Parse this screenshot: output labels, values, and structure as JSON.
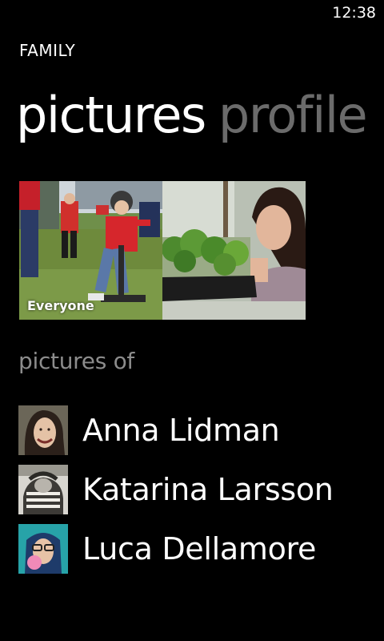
{
  "status_bar": {
    "time": "12:38"
  },
  "app": {
    "title": "FAMILY"
  },
  "pivot": {
    "headers": [
      {
        "label": "pictures",
        "active": true
      },
      {
        "label": "profile",
        "active": false
      }
    ]
  },
  "tiles": [
    {
      "caption": "Everyone",
      "image": "boy-playing-tball-photo"
    },
    {
      "caption": "",
      "image": "woman-holding-plants-photo"
    }
  ],
  "section": {
    "label": "pictures of"
  },
  "people": [
    {
      "name": "Anna Lidman",
      "avatar": "anna-avatar-photo"
    },
    {
      "name": "Katarina Larsson",
      "avatar": "katarina-avatar-photo"
    },
    {
      "name": "Luca Dellamore",
      "avatar": "luca-avatar-photo"
    }
  ],
  "colors": {
    "background": "#000000",
    "foreground": "#ffffff",
    "inactive_header": "#6b6b6b",
    "subtle_text": "#8c8c8c"
  }
}
